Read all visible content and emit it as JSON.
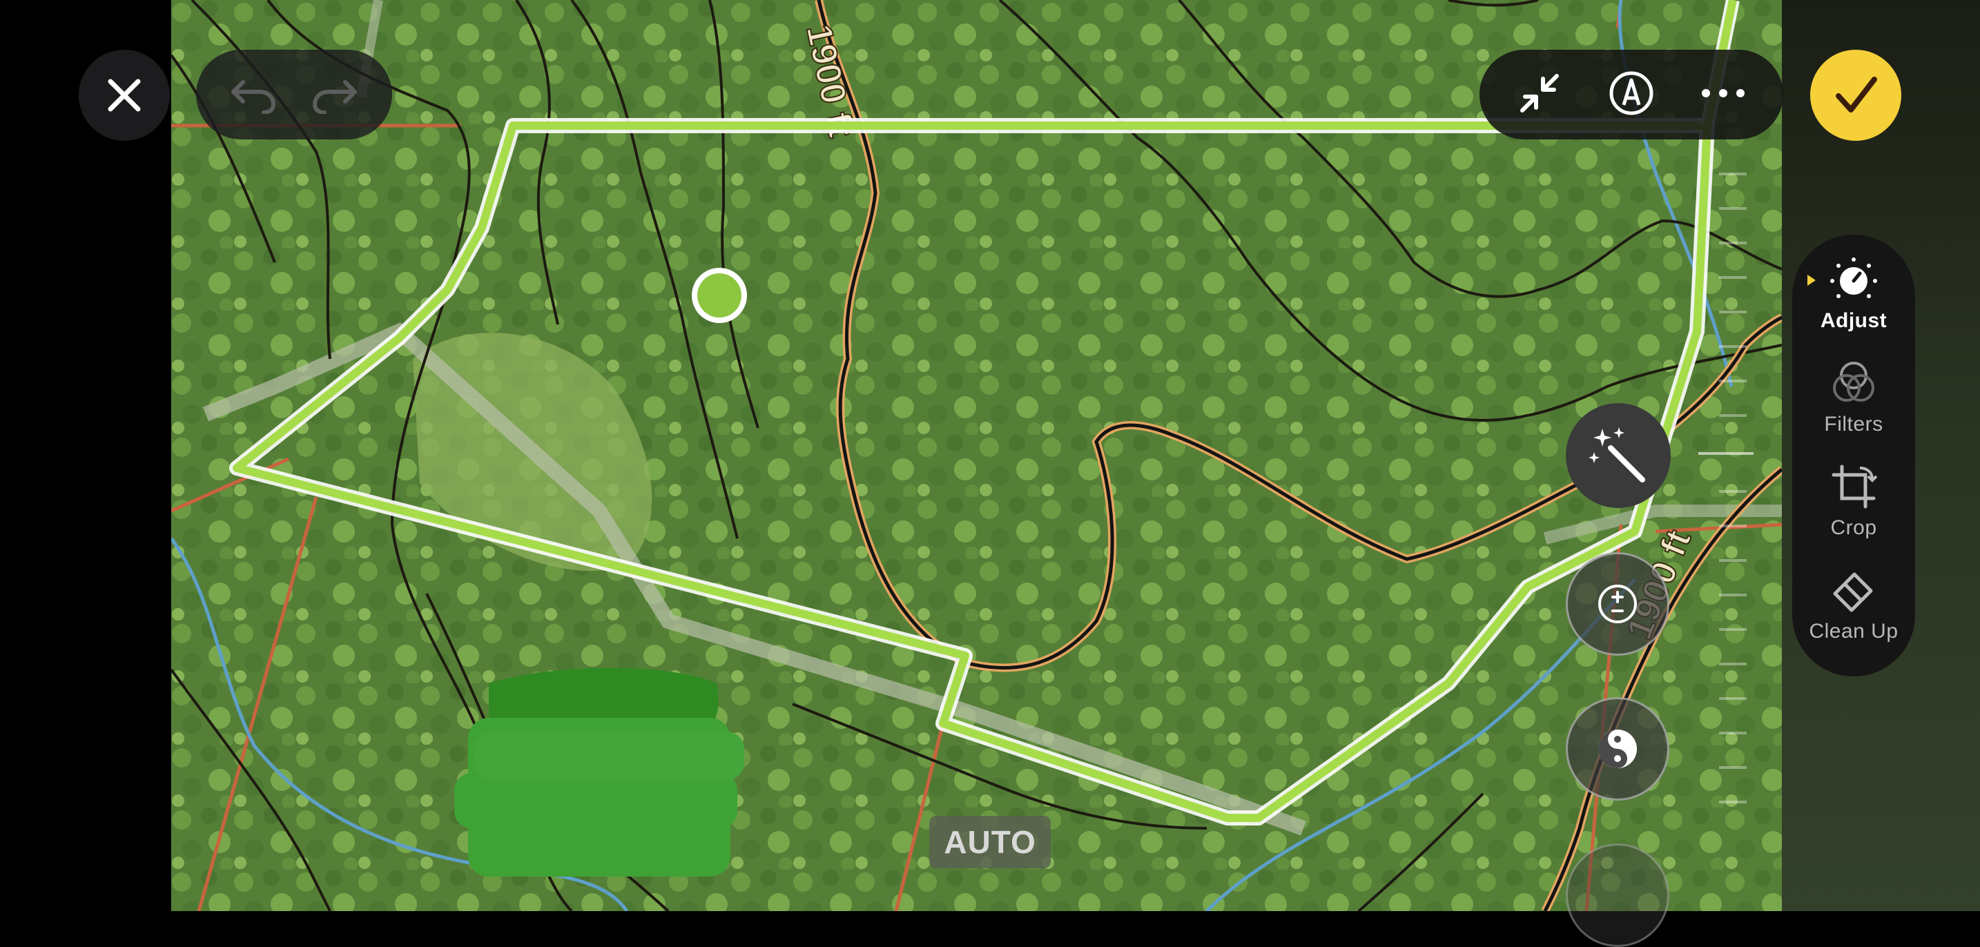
{
  "toolbar": {
    "close_icon": "close-icon",
    "undo_icon": "undo-icon",
    "redo_icon": "redo-icon",
    "minimize_icon": "arrows-collapse-icon",
    "markup_icon": "pen-markup-icon",
    "more_icon": "ellipsis-icon",
    "done_icon": "checkmark-icon",
    "accent_color": "#f6d039"
  },
  "side_menu": {
    "items": [
      {
        "label": "Adjust",
        "icon": "dial-icon",
        "active": true
      },
      {
        "label": "Filters",
        "icon": "filters-icon",
        "active": false
      },
      {
        "label": "Crop",
        "icon": "crop-icon",
        "active": false
      },
      {
        "label": "Clean Up",
        "icon": "eraser-icon",
        "active": false
      }
    ]
  },
  "adjust_tools": {
    "auto_enhance_icon": "magic-wand-icon",
    "exposure_icon": "exposure-plus-minus-icon",
    "contrast_icon": "contrast-yin-yang-icon",
    "auto_label": "AUTO"
  },
  "map": {
    "contour_labels": [
      "1900 ft",
      "1900 ft"
    ],
    "boundary_color": "#a6dc4a",
    "marker_color": "#8dc63f"
  }
}
